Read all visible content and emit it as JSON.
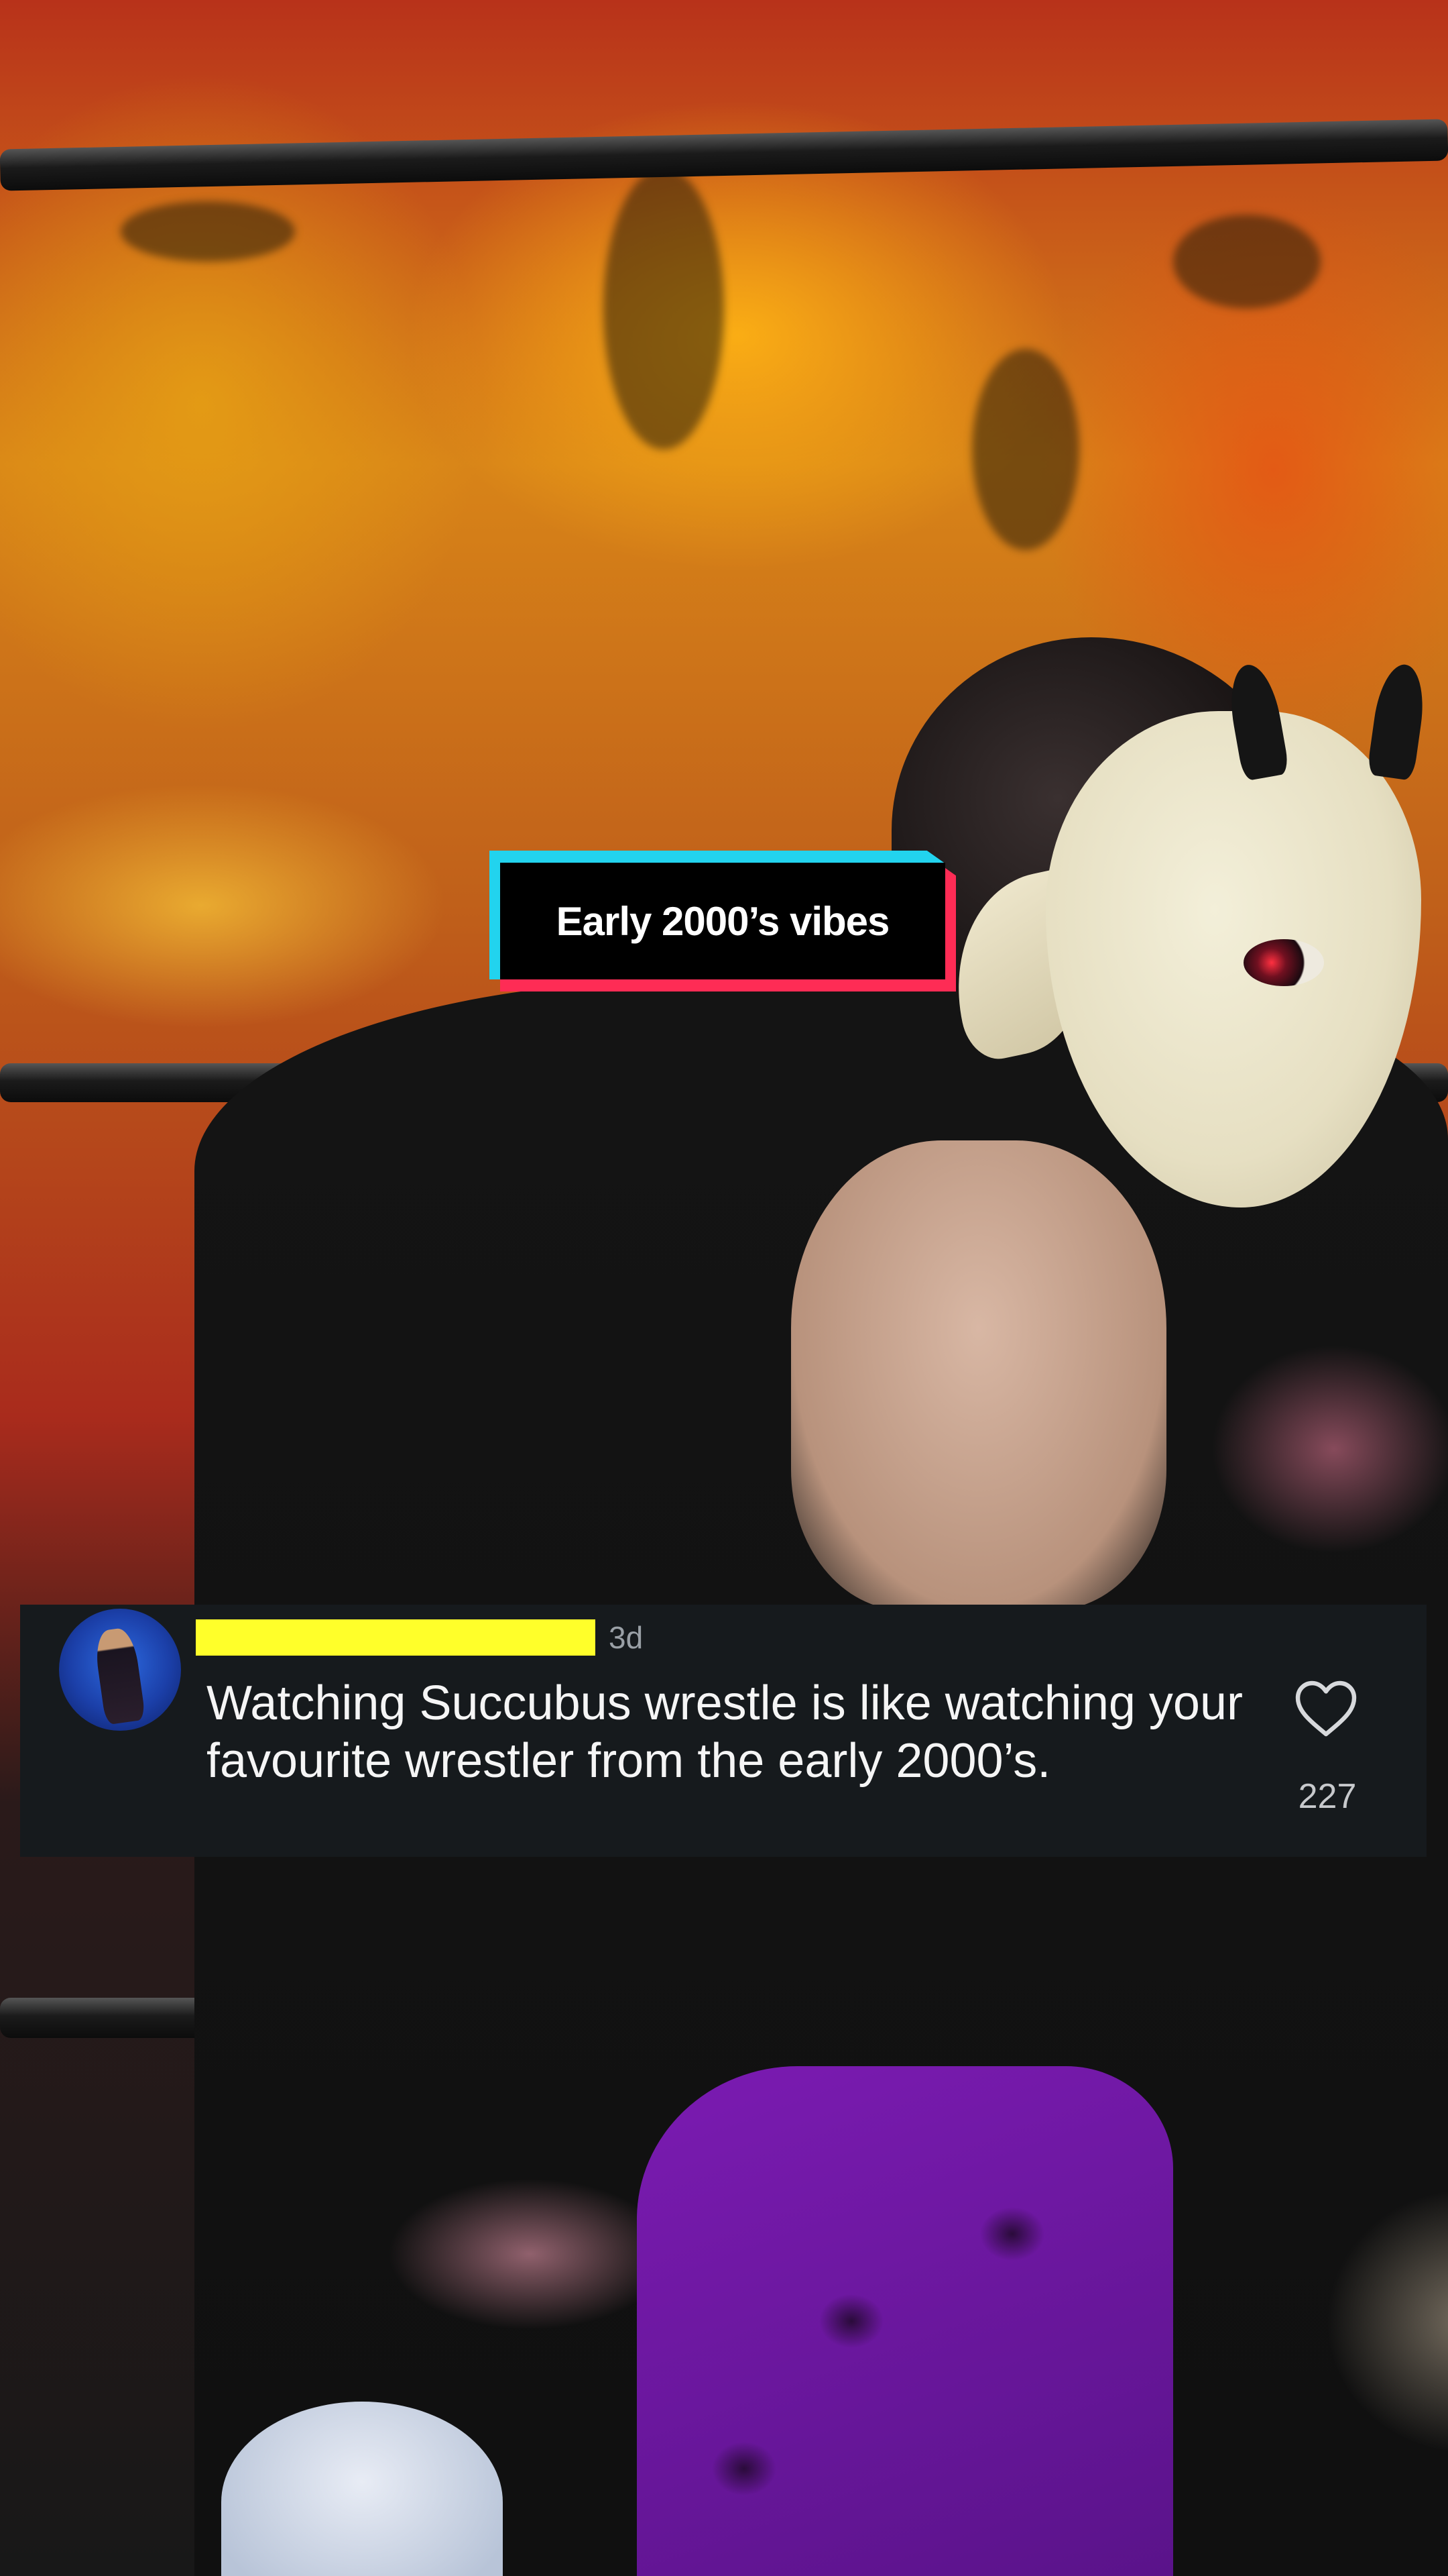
{
  "caption_sticker": {
    "text": "Early 2000’s vibes",
    "colors": {
      "primary": "#22d3ee",
      "secondary": "#fe2c55",
      "fill": "#000000",
      "text": "#ffffff"
    }
  },
  "comment": {
    "username_redaction_color": "#ffff2a",
    "time": "3d",
    "text": "Watching Succubus wrestle is like watching your favourite wrestler from the early 2000’s.",
    "like_count": "227",
    "like_icon": "heart-outline-icon",
    "card_background": "#161a1d"
  }
}
